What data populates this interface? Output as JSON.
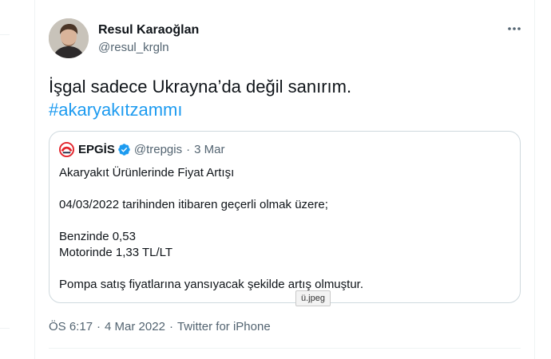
{
  "tweet": {
    "author": {
      "name": "Resul Karaoğlan",
      "handle": "@resul_krgln"
    },
    "text": "İşgal sadece Ukrayna’da değil sanırım.",
    "hashtag": "#akaryakıtzammı",
    "time": "ÖS 6:17",
    "date": "4 Mar 2022",
    "source": "Twitter for iPhone",
    "separator": "·"
  },
  "quoted": {
    "author": {
      "name": "EPGİS",
      "handle": "@trepgis"
    },
    "date": "3 Mar",
    "separator": "·",
    "lines": {
      "l1": "Akaryakıt Ürünlerinde Fiyat Artışı",
      "l2": "04/03/2022 tarihinden itibaren geçerli olmak üzere;",
      "l3": "Benzinde 0,53",
      "l4": "Motorinde 1,33 TL/LT",
      "l5": "Pompa satış fiyatlarına yansıyacak şekilde artış olmuştur."
    }
  },
  "tooltip": "ü.jpeg",
  "colors": {
    "accent": "#1d9bf0",
    "secondary_text": "#536471",
    "border": "#cfd9de",
    "epgis_red": "#e3242b"
  },
  "icons": {
    "more": "more-horizontal-icon",
    "verified": "verified-badge-icon",
    "logo": "epgis-logo-icon"
  }
}
